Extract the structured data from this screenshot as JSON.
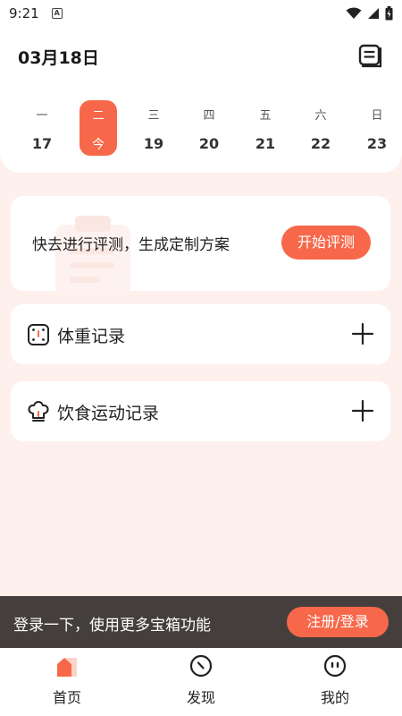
{
  "status_bar": {
    "time": "9:21"
  },
  "header": {
    "date": "03月18日"
  },
  "week": [
    {
      "weekday": "一",
      "date": "17"
    },
    {
      "weekday": "二",
      "date": "今",
      "today": true
    },
    {
      "weekday": "三",
      "date": "19"
    },
    {
      "weekday": "四",
      "date": "20"
    },
    {
      "weekday": "五",
      "date": "21"
    },
    {
      "weekday": "六",
      "date": "22"
    },
    {
      "weekday": "日",
      "date": "23"
    }
  ],
  "evaluation": {
    "text": "快去进行评测，生成定制方案",
    "button_label": "开始评测"
  },
  "records": {
    "weight_label": "体重记录",
    "diet_label": "饮食运动记录"
  },
  "login_bar": {
    "text": "登录一下，使用更多宝箱功能",
    "button_label": "注册/登录"
  },
  "nav": {
    "home": "首页",
    "discover": "发现",
    "mine": "我的"
  },
  "colors": {
    "accent": "#f7684a",
    "background": "#fdf0ed",
    "login_bar": "#443f3c"
  }
}
